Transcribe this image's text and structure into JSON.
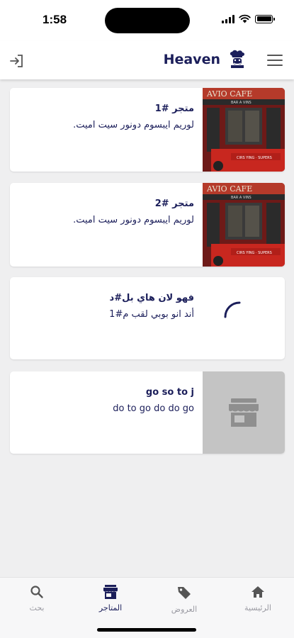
{
  "status_bar": {
    "time": "1:58"
  },
  "header": {
    "brand_name": "Heaven"
  },
  "stores": [
    {
      "name": "متجر #1",
      "description": "لوريم ايبسوم دونور سيت اميت.",
      "image": "storefront-photo"
    },
    {
      "name": "متجر #2",
      "description": "لوريم ايبسوم دونور سيت اميت.",
      "image": "storefront-photo"
    },
    {
      "name": "فهو لان هاي بل#د",
      "description": "أند انو بوبي لقب م#1",
      "image": "loading-spinner"
    },
    {
      "name": "go so to j",
      "description": "do to go do do go",
      "image": "store-placeholder-icon"
    }
  ],
  "tabs": [
    {
      "label": "الرئيسية",
      "icon": "home-icon"
    },
    {
      "label": "العروض",
      "icon": "tag-icon"
    },
    {
      "label": "المتاجر",
      "icon": "store-icon",
      "active": true
    },
    {
      "label": "بحث",
      "icon": "search-icon"
    }
  ],
  "colors": {
    "primary": "#1b1e5a",
    "background": "#efeff0",
    "card": "#ffffff",
    "inactive_tab": "#9a9aa2"
  }
}
